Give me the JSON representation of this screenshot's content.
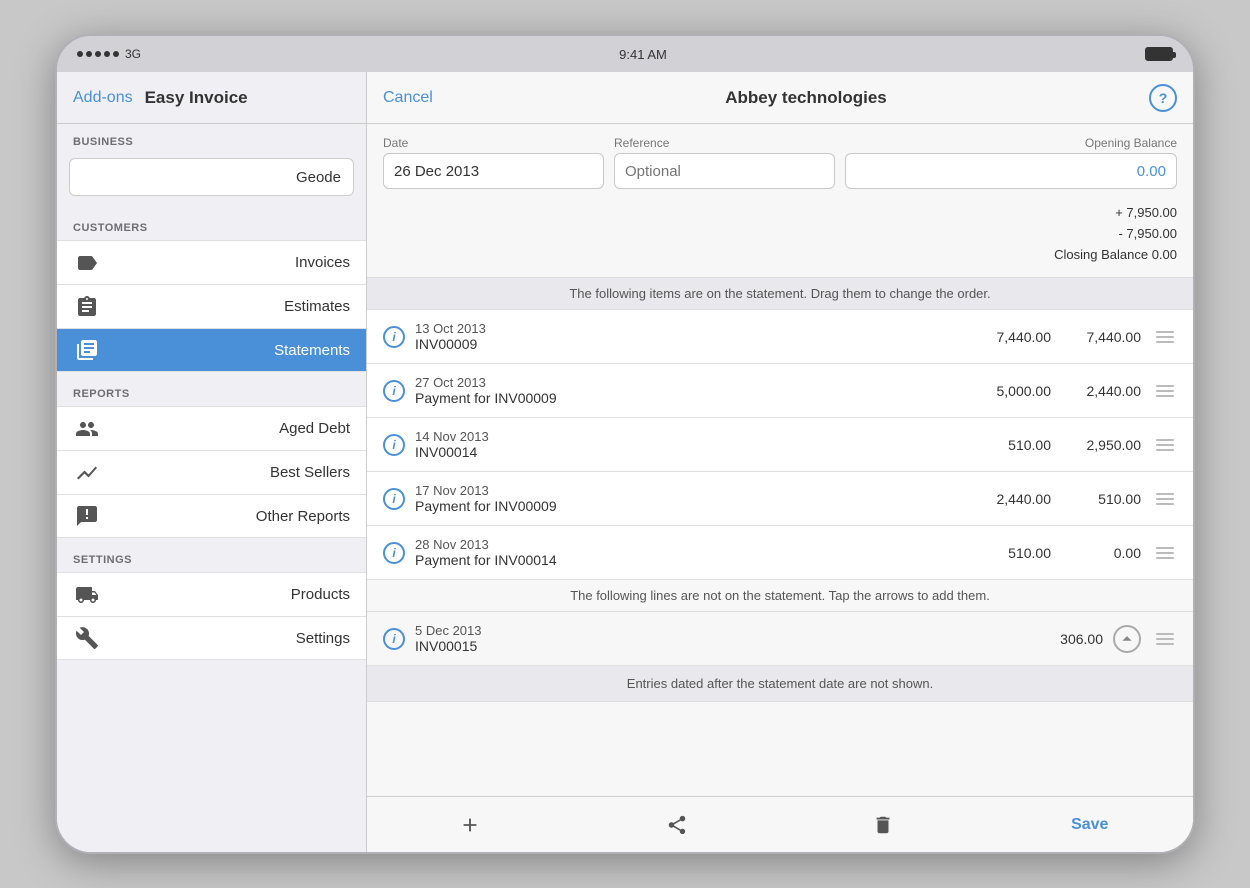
{
  "statusBar": {
    "signal": "3G",
    "time": "9:41 AM",
    "battery": "full"
  },
  "sidebar": {
    "addons_label": "Add-ons",
    "app_title": "Easy Invoice",
    "business_section": "BUSINESS",
    "business_value": "Geode",
    "customers_section": "CUSTOMERS",
    "customers_items": [
      {
        "id": "invoices",
        "label": "Invoices",
        "icon": "tag"
      },
      {
        "id": "estimates",
        "label": "Estimates",
        "icon": "clipboard"
      },
      {
        "id": "statements",
        "label": "Statements",
        "icon": "stack",
        "active": true
      }
    ],
    "reports_section": "REPORTS",
    "reports_items": [
      {
        "id": "aged-debt",
        "label": "Aged Debt",
        "icon": "people"
      },
      {
        "id": "best-sellers",
        "label": "Best Sellers",
        "icon": "chart"
      },
      {
        "id": "other-reports",
        "label": "Other Reports",
        "icon": "report"
      }
    ],
    "settings_section": "SETTINGS",
    "settings_items": [
      {
        "id": "products",
        "label": "Products",
        "icon": "truck"
      },
      {
        "id": "settings",
        "label": "Settings",
        "icon": "tools"
      }
    ]
  },
  "header": {
    "cancel_label": "Cancel",
    "title": "Abbey technologies",
    "help_label": "?"
  },
  "form": {
    "date_label": "Date",
    "date_value": "26 Dec 2013",
    "reference_label": "Reference",
    "reference_placeholder": "Optional",
    "balance_label": "Opening Balance",
    "balance_value": "0.00",
    "total_plus": "+ 7,950.00",
    "total_minus": "- 7,950.00",
    "closing_balance": "Closing Balance 0.00"
  },
  "statement": {
    "on_statement_note": "The following items are on the statement. Drag them to change the order.",
    "rows": [
      {
        "date": "13 Oct 2013",
        "ref": "INV00009",
        "amount": "7,440.00",
        "balance": "7,440.00"
      },
      {
        "date": "27 Oct 2013",
        "ref": "Payment for INV00009",
        "amount": "5,000.00",
        "balance": "2,440.00"
      },
      {
        "date": "14 Nov 2013",
        "ref": "INV00014",
        "amount": "510.00",
        "balance": "2,950.00"
      },
      {
        "date": "17 Nov 2013",
        "ref": "Payment for INV00009",
        "amount": "2,440.00",
        "balance": "510.00"
      },
      {
        "date": "28 Nov 2013",
        "ref": "Payment for INV00014",
        "amount": "510.00",
        "balance": "0.00"
      }
    ],
    "not_on_statement_note": "The following lines are not on the statement. Tap the arrows to add them.",
    "not_on_rows": [
      {
        "date": "5 Dec 2013",
        "ref": "INV00015",
        "amount": "306.00"
      }
    ],
    "footer_note": "Entries dated after the statement date are not shown."
  },
  "toolbar": {
    "add_label": "+",
    "share_label": "share",
    "delete_label": "delete",
    "save_label": "Save"
  }
}
